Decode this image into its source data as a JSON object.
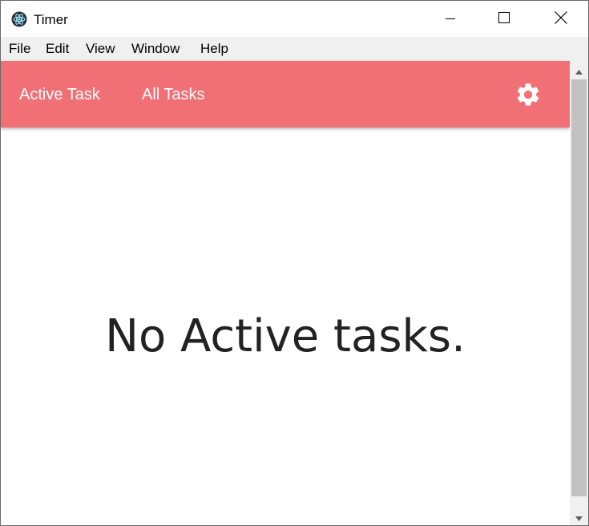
{
  "window": {
    "title": "Timer",
    "app_icon": "electron-atom-icon"
  },
  "window_controls": {
    "minimize_icon": "minimize-icon",
    "maximize_icon": "maximize-icon",
    "close_icon": "close-icon"
  },
  "menu": {
    "items": [
      {
        "label": "File"
      },
      {
        "label": "Edit"
      },
      {
        "label": "View"
      },
      {
        "label": "Window"
      },
      {
        "label": "Help"
      }
    ]
  },
  "appbar": {
    "tabs": [
      {
        "label": "Active Task"
      },
      {
        "label": "All Tasks"
      }
    ],
    "settings_icon": "gear-icon",
    "color": "#f07075"
  },
  "main": {
    "empty_message": "No Active tasks."
  },
  "scrollbar": {
    "up_icon": "scroll-up-arrow-icon",
    "down_icon": "scroll-down-arrow-icon"
  }
}
